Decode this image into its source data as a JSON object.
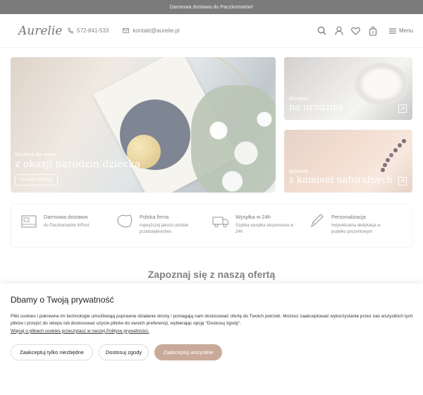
{
  "topbar": {
    "text": "Darmowa dostawa do Paczkomatów!"
  },
  "header": {
    "logo": "Aurelie",
    "phone": "572-841-533",
    "email": "kontakt@aurelie.pl",
    "menu_label": "Menu",
    "icons": [
      "search-icon",
      "user-icon",
      "heart-icon",
      "bag-icon",
      "menu-icon"
    ],
    "cart_count": "0"
  },
  "banners": {
    "main": {
      "small": "Biżuteria dla mamy",
      "big": "z okazji narodzin dziecka",
      "button": "Sprawdź kolekcję"
    },
    "side1": {
      "small": "Biżuteria",
      "big": "na urodziny"
    },
    "side2": {
      "small": "Biżuteria",
      "big": "z kamieni naturalnych"
    }
  },
  "features": [
    {
      "title": "Darmowa dostawa",
      "desc": "do Paczkomatów InPost",
      "icon": "parcel-icon"
    },
    {
      "title": "Polska firma",
      "desc": "najwyższej jakości polskie przedsiębiorstwo",
      "icon": "poland-map-icon"
    },
    {
      "title": "Wysyłka w 24h",
      "desc": "Szybka wysyłka ekspresowa w 24h",
      "icon": "truck-icon"
    },
    {
      "title": "Personalizacja",
      "desc": "Indywidualna dedykacja w pudełku prezentowym",
      "icon": "pen-icon"
    }
  ],
  "section_title": "Zapoznaj się z naszą ofertą",
  "cookie": {
    "title": "Dbamy o Twoją prywatność",
    "text": "Pliki cookies i pokrewne im technologie umożliwiają poprawne działanie strony i pomagają nam dostosować ofertę do Twoich potrzeb. Możesz zaakceptować wykorzystanie przez nas wszystkich tych plików i przejść do sklepu lub dostosować użycie plików do swoich preferencji, wybierając opcję \"Dostosuj zgody\".",
    "link": "Więcej o plikach cookies przeczytasz w naszej Polityce prywatności.",
    "btn_necessary": "Zaakceptuj tylko niezbędne",
    "btn_customize": "Dostosuj zgody",
    "btn_accept_all": "Zaakceptuj wszystkie"
  }
}
